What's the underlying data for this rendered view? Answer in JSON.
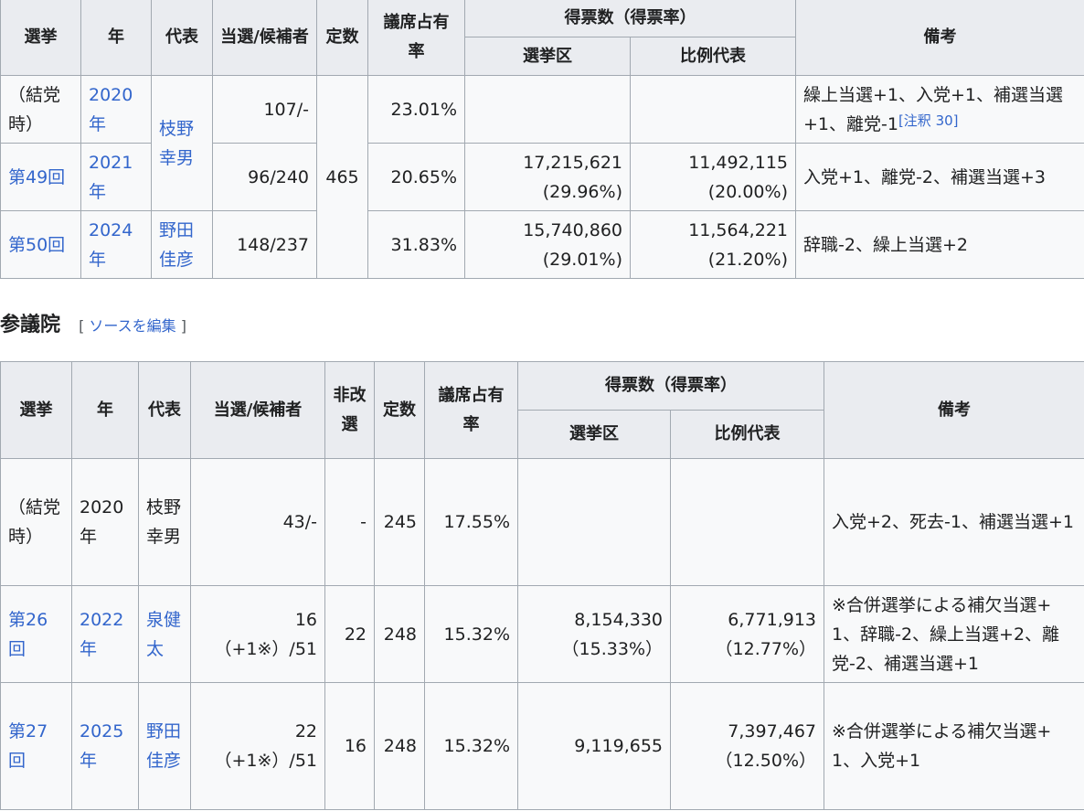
{
  "house": {
    "headers": {
      "election": "選挙",
      "year": "年",
      "leader": "代表",
      "elected": "当選/候補者",
      "seats": "定数",
      "share": "議席占有率",
      "votes_group": "得票数（得票率）",
      "district": "選挙区",
      "pr": "比例代表",
      "notes": "備考"
    },
    "rows": [
      {
        "election": "（結党時）",
        "year": "2020年",
        "elected": "107/-",
        "share": "23.01%",
        "district_votes": "",
        "district_rate": "",
        "pr_votes": "",
        "pr_rate": "",
        "notes": "繰上当選+1、入党+1、補選当選+1、離党-1",
        "footnote": "[注釈 30]"
      },
      {
        "election": "第49回",
        "year": "2021年",
        "elected": "96/240",
        "share": "20.65%",
        "district_votes": "17,215,621",
        "district_rate": "(29.96%)",
        "pr_votes": "11,492,115",
        "pr_rate": "(20.00%)",
        "notes": "入党+1、離党-2、補選当選+3"
      },
      {
        "election": "第50回",
        "year": "2024年",
        "elected": "148/237",
        "share": "31.83%",
        "district_votes": "15,740,860",
        "district_rate": "(29.01%)",
        "pr_votes": "11,564,221",
        "pr_rate": "(21.20%)",
        "notes": "辞職-2、繰上当選+2"
      }
    ],
    "leaders": [
      "枝野幸男",
      "野田佳彦"
    ],
    "seats_total": "465"
  },
  "councillors": {
    "heading": "参議院",
    "edit_open": "[",
    "edit_label": "ソースを編集",
    "edit_close": "]",
    "headers": {
      "election": "選挙",
      "year": "年",
      "leader": "代表",
      "elected": "当選/候補者",
      "unrenewed": "非改選",
      "seats": "定数",
      "share": "議席占有率",
      "votes_group": "得票数（得票率）",
      "district": "選挙区",
      "pr": "比例代表",
      "notes": "備考"
    },
    "rows": [
      {
        "election": "（結党時）",
        "year": "2020年",
        "leader": "枝野幸男",
        "elected": "43/-",
        "elected_sub": "",
        "unrenewed": "-",
        "seats": "245",
        "share": "17.55%",
        "district_votes": "",
        "district_rate": "",
        "pr_votes": "",
        "pr_rate": "",
        "notes": "入党+2、死去-1、補選当選+1"
      },
      {
        "election": "第26回",
        "year": "2022年",
        "leader": "泉健太",
        "elected": "16",
        "elected_sub": "（+1※）/51",
        "unrenewed": "22",
        "seats": "248",
        "share": "15.32%",
        "district_votes": "8,154,330",
        "district_rate": "（15.33%）",
        "pr_votes": "6,771,913",
        "pr_rate": "（12.77%）",
        "notes": "※合併選挙による補欠当選+1、辞職-2、繰上当選+2、離党-2、補選当選+1"
      },
      {
        "election": "第27回",
        "year": "2025年",
        "leader": "野田佳彦",
        "elected": "22",
        "elected_sub": "（+1※）/51",
        "unrenewed": "16",
        "seats": "248",
        "share": "15.32%",
        "district_votes": "9,119,655",
        "district_rate": "",
        "pr_votes": "7,397,467",
        "pr_rate": "（12.50%）",
        "notes": "※合併選挙による補欠当選+1、入党+1"
      }
    ]
  },
  "colors": {
    "link": "#3366cc",
    "header_bg": "#eaecf0",
    "cell_bg": "#f8f9fa",
    "border": "#a2a9b1"
  }
}
